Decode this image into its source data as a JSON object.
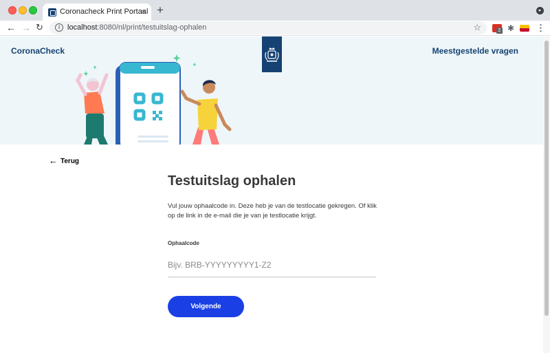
{
  "browser": {
    "tab_title": "Coronacheck Print Portaal",
    "tab_close": "×",
    "new_tab": "+",
    "back": "←",
    "forward": "→",
    "reload": "↻",
    "url_host": "localhost",
    "url_path": ":8080/nl/print/testuitslag-ophalen",
    "star": "☆",
    "extension_badge": "2",
    "puzzle": "✱",
    "menu": "⋮"
  },
  "header": {
    "brand": "CoronaCheck",
    "faq_link": "Meestgestelde vragen"
  },
  "page": {
    "back_label": "Terug",
    "back_arrow": "←",
    "title": "Testuitslag ophalen",
    "intro": "Vul jouw ophaalcode in. Deze heb je van de testlocatie gekregen. Of klik op de link in de e-mail die je van je testlocatie krijgt.",
    "field_label": "Ophaalcode",
    "field_value": "",
    "field_placeholder": "Bijv. BRB-YYYYYYYYY1-Z2",
    "submit_label": "Volgende"
  },
  "colors": {
    "brand": "#154273",
    "hero_bg": "#eef6f9",
    "primary_button": "#1a3fe5",
    "phone": "#2c5fb8",
    "qr": "#38b7d1"
  }
}
